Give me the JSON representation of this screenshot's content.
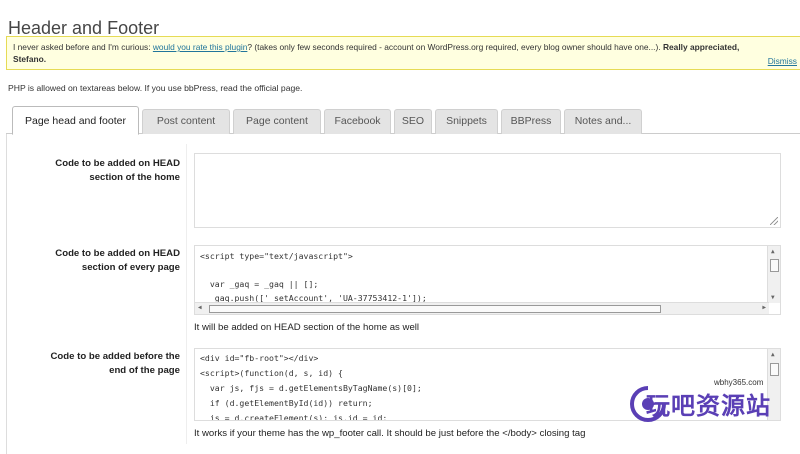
{
  "page": {
    "title": "Header and Footer"
  },
  "notice": {
    "text_before": "I never asked before and I'm curious: ",
    "link_text": "would you rate this plugin",
    "text_after": "? (takes only few seconds required - account on WordPress.org required, every blog owner should have one...). ",
    "bold_text": "Really appreciated,",
    "signature": "Stefano.",
    "dismiss": "Dismiss"
  },
  "php_note": "PHP is allowed on textareas below. If you use bbPress, read the official page.",
  "tabs": [
    {
      "label": "Page head and footer",
      "active": true
    },
    {
      "label": "Post content",
      "active": false
    },
    {
      "label": "Page content",
      "active": false
    },
    {
      "label": "Facebook",
      "active": false
    },
    {
      "label": "SEO",
      "active": false
    },
    {
      "label": "Snippets",
      "active": false
    },
    {
      "label": "BBPress",
      "active": false
    },
    {
      "label": "Notes and...",
      "active": false
    }
  ],
  "fields": {
    "head_home": {
      "label_line1": "Code to be added on HEAD",
      "label_line2": "section of the home",
      "value": ""
    },
    "head_every_page": {
      "label_line1": "Code to be added on HEAD",
      "label_line2": "section of every page",
      "lines": [
        "<script type=\"text/javascript\">",
        "",
        "  var _gaq = _gaq || [];",
        "  _gaq.push(['_setAccount', 'UA-37753412-1']);"
      ],
      "hint": "It will be added on HEAD section of the home as well"
    },
    "before_body_end": {
      "label_line1": "Code to be added before the",
      "label_line2": "end of the page",
      "lines": [
        "<div id=\"fb-root\"></div>",
        "<script>(function(d, s, id) {",
        "  var js, fjs = d.getElementsByTagName(s)[0];",
        "  if (d.getElementById(id)) return;",
        "  js = d.createElement(s); js.id = id;"
      ],
      "hint": "It works if your theme has the wp_footer call. It should be just before the </body> closing tag"
    }
  },
  "watermark": {
    "url": "wbhy365.com",
    "text": "玩吧资源站"
  },
  "colors": {
    "notice_bg": "#ffffe0",
    "notice_border": "#e6db55",
    "link": "#21759b",
    "watermark": "#5a3fb5"
  }
}
